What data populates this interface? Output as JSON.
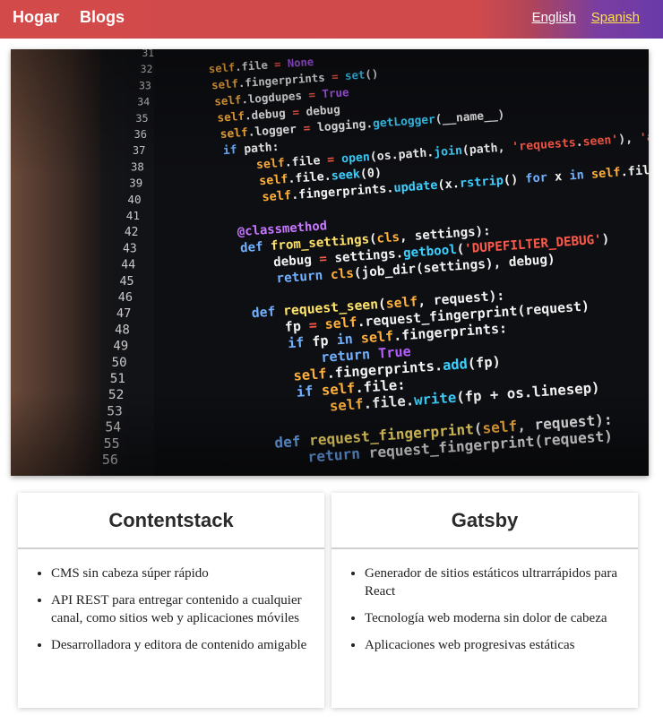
{
  "nav": {
    "home_label": "Hogar",
    "blogs_label": "Blogs",
    "lang_english": "English",
    "lang_spanish": "Spanish"
  },
  "hero": {
    "image_semantic": "code-editor-photo",
    "line_numbers": [
      "31",
      "32",
      "33",
      "34",
      "35",
      "36",
      "37",
      "38",
      "39",
      "40",
      "41",
      "42",
      "43",
      "44",
      "45",
      "46",
      "47",
      "48",
      "49",
      "50",
      "51",
      "52",
      "53",
      "54",
      "55",
      "56"
    ],
    "code_lines": [
      [
        "",
        ""
      ],
      [
        "self.file = ",
        "None"
      ],
      [
        "self.fingerprints = ",
        "set()"
      ],
      [
        "self.logdupes = ",
        "True"
      ],
      [
        "self.debug = ",
        "debug"
      ],
      [
        "self.logger = logging.",
        "getLogger(__name__)"
      ],
      [
        "if path:",
        ""
      ],
      [
        "    self.file = ",
        "open(os.path.join(path, 'requests.seen'), 'a+')"
      ],
      [
        "    self.file.",
        "seek(0)"
      ],
      [
        "    self.fingerprints.",
        "update(x.rstrip() for x in self.file)"
      ],
      [
        "",
        ""
      ],
      [
        "@classmethod",
        ""
      ],
      [
        "def from_settings(cls, settings):",
        ""
      ],
      [
        "    debug = settings.",
        "getbool('DUPEFILTER_DEBUG')"
      ],
      [
        "    return cls(job_dir(settings), debug)",
        ""
      ],
      [
        "",
        ""
      ],
      [
        "def request_seen(self, request):",
        ""
      ],
      [
        "    fp = self.request_fingerprint(request)",
        ""
      ],
      [
        "    if fp in self.fingerprints:",
        ""
      ],
      [
        "        return True",
        ""
      ],
      [
        "    self.fingerprints.",
        "add(fp)"
      ],
      [
        "    if self.file:",
        ""
      ],
      [
        "        self.file.write(fp + os.linesep)",
        ""
      ],
      [
        "",
        ""
      ],
      [
        "def request_fingerprint(self, request):",
        ""
      ],
      [
        "    return request_fingerprint(request)",
        ""
      ]
    ]
  },
  "cards": [
    {
      "title": "Contentstack",
      "items": [
        "CMS sin cabeza súper rápido",
        "API REST para entregar contenido a cualquier canal, como sitios web y aplicaciones móviles",
        "Desarrolladora y editora de contenido amigable"
      ]
    },
    {
      "title": "Gatsby",
      "items": [
        "Generador de sitios estáticos ultrarrápidos para React",
        "Tecnología web moderna sin dolor de cabeza",
        "Aplicaciones web progresivas estáticas"
      ]
    }
  ],
  "colors": {
    "header_red": "#d24a4a",
    "header_purple": "#6a3aa8",
    "spanish_link": "#ffe14a"
  }
}
